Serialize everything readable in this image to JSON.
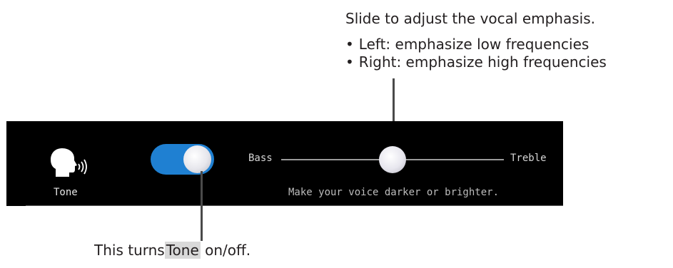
{
  "callout_top": {
    "heading": "Slide to adjust the vocal emphasis.",
    "bullets": [
      "Left: emphasize low frequencies",
      "Right: emphasize high frequencies"
    ]
  },
  "panel": {
    "tone_label": "Tone",
    "toggle_state": "on",
    "slider": {
      "min_label": "Bass",
      "max_label": "Treble",
      "value": 0.5
    },
    "hint": "Make your voice darker or brighter."
  },
  "callout_bottom": {
    "prefix": "This turns",
    "highlight": "Tone",
    "suffix": " on/off."
  },
  "colors": {
    "panel_bg": "#000000",
    "toggle_on": "#1f80d2"
  },
  "icons": {
    "tone": "speaking-head-icon"
  }
}
